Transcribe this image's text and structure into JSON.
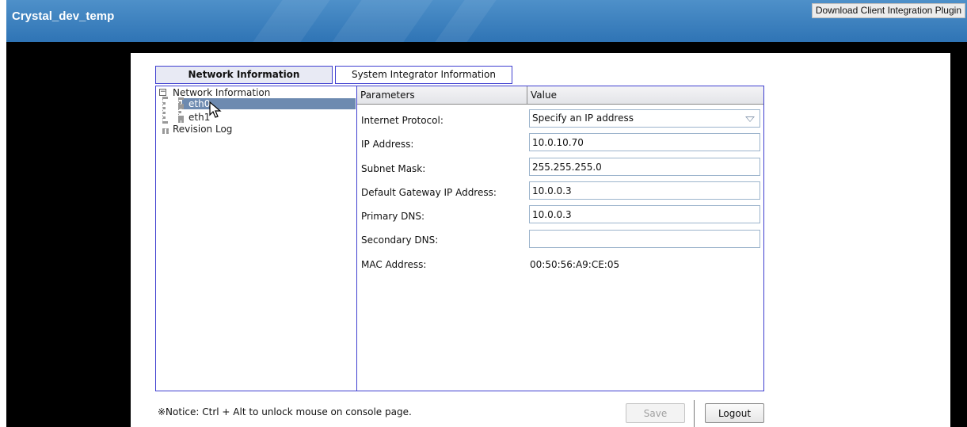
{
  "app": {
    "title": "Crystal_dev_temp",
    "download_plugin_label": "Download Client Integration Plugin"
  },
  "tabs": [
    {
      "label": "Network Information",
      "active": true
    },
    {
      "label": "System Integrator Information",
      "active": false
    }
  ],
  "tree": {
    "root_label": "Network Information",
    "children": [
      "eth0",
      "eth1"
    ],
    "selected": "eth0",
    "revision_label": "Revision Log"
  },
  "table": {
    "headers": {
      "parameters": "Parameters",
      "value": "Value"
    },
    "rows": {
      "protocol": {
        "label": "Internet Protocol:",
        "value": "Specify an IP address"
      },
      "ip": {
        "label": "IP Address:",
        "value": "10.0.10.70"
      },
      "subnet": {
        "label": "Subnet Mask:",
        "value": "255.255.255.0"
      },
      "gateway": {
        "label": "Default Gateway IP Address:",
        "value": "10.0.0.3"
      },
      "dns1": {
        "label": "Primary DNS:",
        "value": "10.0.0.3"
      },
      "dns2": {
        "label": "Secondary DNS:",
        "value": ""
      },
      "mac": {
        "label": "MAC Address:",
        "value": "00:50:56:A9:CE:05"
      }
    }
  },
  "footer": {
    "notice": "※Notice: Ctrl + Alt to unlock mouse on console page.",
    "save_label": "Save",
    "logout_label": "Logout"
  },
  "colors": {
    "banner": "#3a7fc0",
    "border_accent": "#3f3fd0",
    "selection": "#6d8ab0"
  }
}
